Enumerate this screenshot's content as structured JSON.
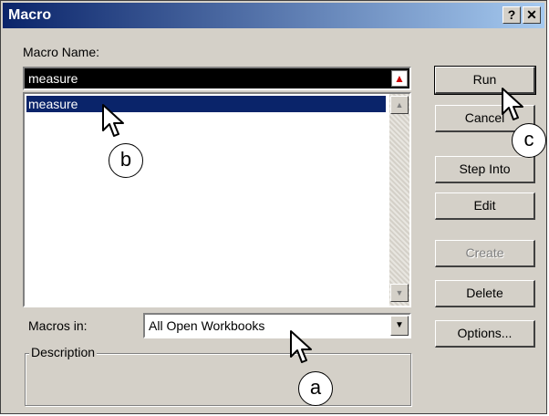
{
  "title": "Macro",
  "title_buttons": {
    "help": "?",
    "close": "✕"
  },
  "macro_name": {
    "label": "Macro Name:",
    "value": "measure"
  },
  "macro_list": [
    "measure"
  ],
  "macros_in": {
    "label": "Macros in:",
    "value": "All Open Workbooks"
  },
  "description": {
    "label": "Description"
  },
  "buttons": {
    "run": "Run",
    "cancel": "Cancel",
    "step_into": "Step Into",
    "edit": "Edit",
    "create": "Create",
    "delete": "Delete",
    "options": "Options..."
  },
  "callouts": {
    "a": "a",
    "b": "b",
    "c": "c"
  },
  "colors": {
    "selection": "#0a246a",
    "face": "#d4d0c8"
  },
  "icons": {
    "title_help": "help-icon",
    "title_close": "close-icon",
    "scroll_up": "up-arrow-icon",
    "scroll_down": "down-arrow-icon",
    "dropdown": "chevron-down-icon",
    "cursor": "mouse-pointer-icon"
  }
}
